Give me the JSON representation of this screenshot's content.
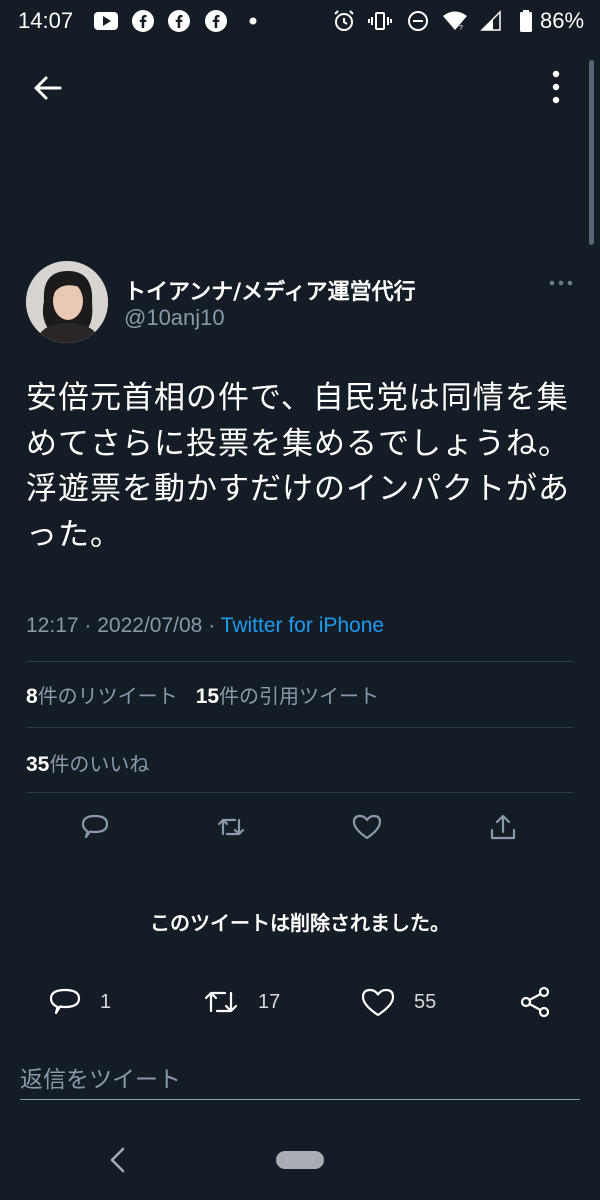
{
  "status_bar": {
    "time": "14:07",
    "left_icons": [
      "youtube-icon",
      "facebook-icon",
      "facebook-icon",
      "facebook-icon",
      "dot-icon"
    ],
    "right_icons": [
      "alarm-icon",
      "vibrate-icon",
      "dnd-icon",
      "wifi-icon",
      "signal-icon",
      "battery-icon"
    ],
    "battery": "86%"
  },
  "header": {
    "back_icon": "arrow-left-icon",
    "more_icon": "vertical-dots-icon"
  },
  "tweet": {
    "display_name": "トイアンナ/メディア運営代行",
    "handle": "@10anj10",
    "text": "安倍元首相の件で、自民党は同情を集めてさらに投票を集めるでしょうね。浮遊票を動かすだけのインパクトがあった。",
    "time": "12:17",
    "separator": "·",
    "date": "2022/07/08",
    "source": "Twitter for iPhone",
    "retweets_count": "8",
    "retweets_label": "件のリツイート",
    "quotes_count": "15",
    "quotes_label": "件の引用ツイート",
    "likes_count": "35",
    "likes_label": "件のいいね"
  },
  "deleted_notice": "このツイートは削除されました。",
  "reply_actions": {
    "replies": "1",
    "retweets": "17",
    "likes": "55"
  },
  "reply_input": {
    "placeholder": "返信をツイート"
  },
  "colors": {
    "background": "#141d26",
    "secondary_text": "#8b98a5",
    "link": "#1d9bf0",
    "divider": "#2f3a45"
  }
}
